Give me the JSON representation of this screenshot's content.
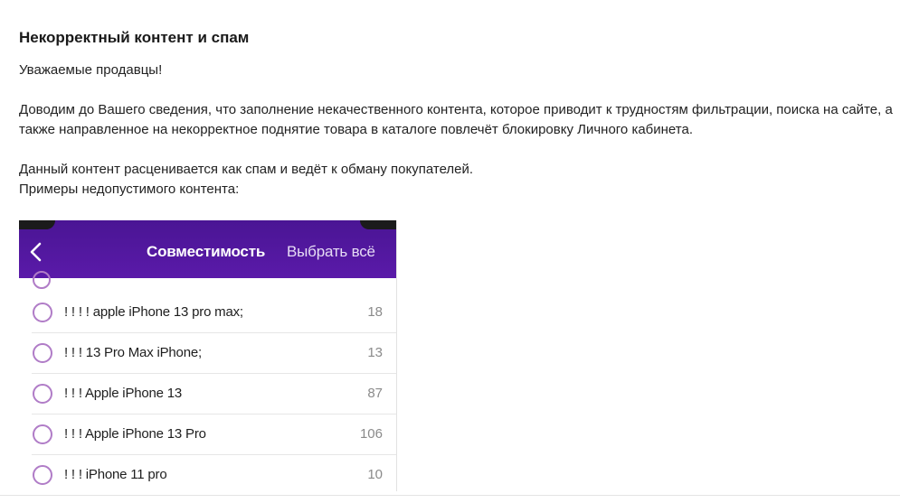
{
  "article": {
    "title": "Некорректный контент и спам",
    "greeting": "Уважаемые продавцы!",
    "notice": "Доводим до Вашего сведения, что заполнение некачественного контента, которое приводит к трудностям фильтрации, поиска на сайте, а также направленное на некорректное поднятие товара в каталоге повлечёт блокировку Личного кабинета.",
    "spam_note": "Данный контент расценивается как спам и ведёт к обману покупателей.",
    "examples_label": "Примеры недопустимого контента:"
  },
  "example_screenshot": {
    "header": {
      "back_icon": "chevron-left-icon",
      "title": "Совместимость",
      "select_all": "Выбрать всё"
    },
    "items": [
      {
        "label": "! ! ! ! apple iPhone 13 pro max;",
        "count": "18"
      },
      {
        "label": "! ! ! 13 Pro Max iPhone;",
        "count": "13"
      },
      {
        "label": "! ! ! Apple iPhone 13",
        "count": "87"
      },
      {
        "label": "! ! ! Apple iPhone 13 Pro",
        "count": "106"
      },
      {
        "label": "! ! ! iPhone 11 pro",
        "count": "10"
      }
    ],
    "colors": {
      "header_bg": "#5a1aa9",
      "radio_border": "#b07cc7"
    }
  }
}
